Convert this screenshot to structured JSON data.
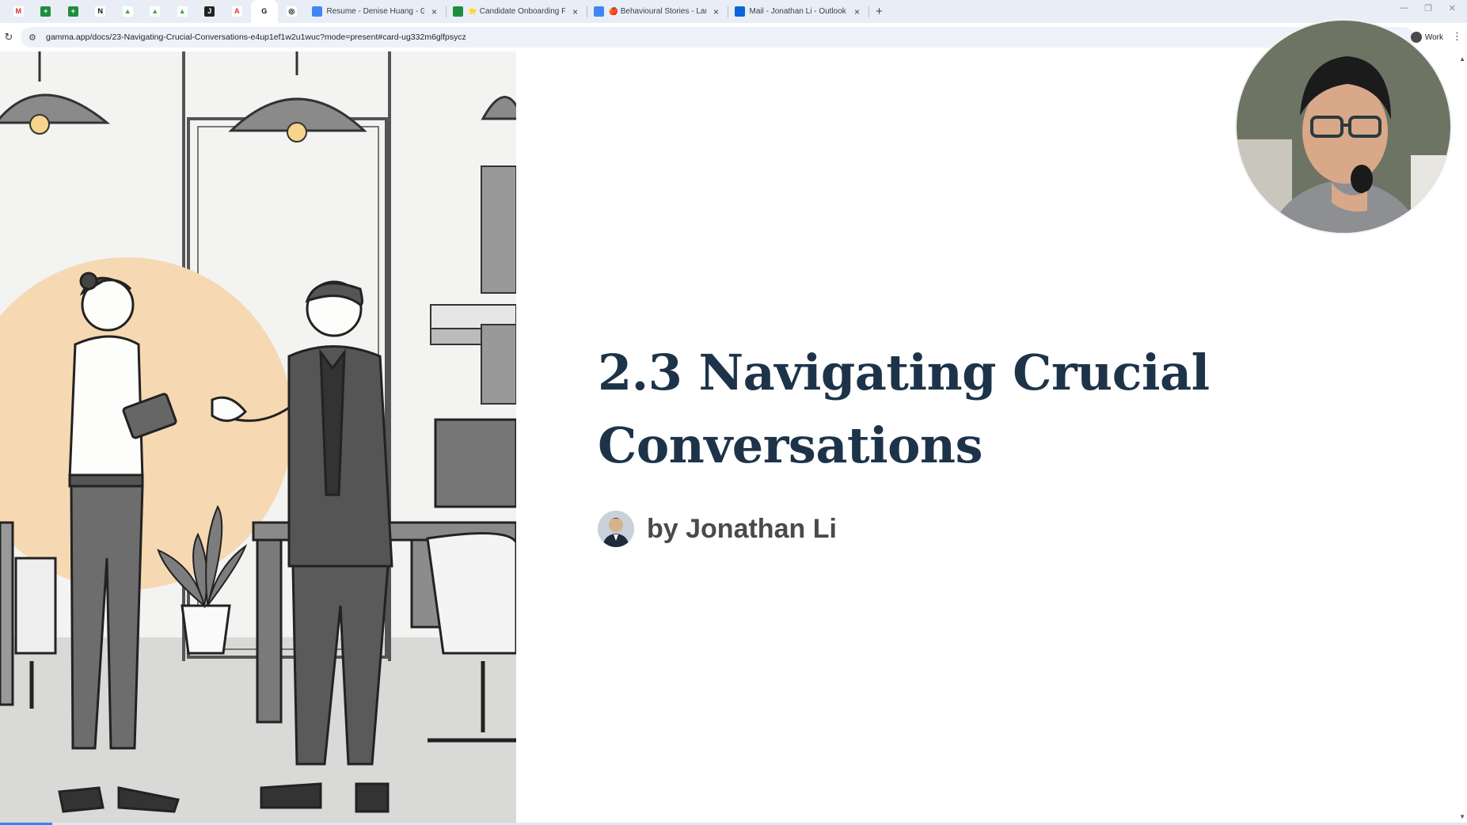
{
  "browser": {
    "pinned_tabs": [
      {
        "icon": "gmail-icon",
        "letter": "M",
        "color": "#ffffff",
        "fg": "#d93025"
      },
      {
        "icon": "sheets-icon",
        "letter": "+",
        "color": "#1e8e3e",
        "fg": "#ffffff"
      },
      {
        "icon": "sheets-icon",
        "letter": "+",
        "color": "#1e8e3e",
        "fg": "#ffffff"
      },
      {
        "icon": "notion-icon",
        "letter": "N",
        "color": "#ffffff",
        "fg": "#111111"
      },
      {
        "icon": "drive-icon",
        "letter": "▲",
        "color": "#ffffff",
        "fg": "#34a853"
      },
      {
        "icon": "drive-icon",
        "letter": "▲",
        "color": "#ffffff",
        "fg": "#34a853"
      },
      {
        "icon": "drive-icon",
        "letter": "▲",
        "color": "#ffffff",
        "fg": "#34a853"
      },
      {
        "icon": "app-icon",
        "letter": "J",
        "color": "#222222",
        "fg": "#ffffff"
      },
      {
        "icon": "acrobat-icon",
        "letter": "A",
        "color": "#ffffff",
        "fg": "#e3322b"
      },
      {
        "icon": "gamma-icon",
        "letter": "G",
        "color": "#ffffff",
        "fg": "#111111"
      },
      {
        "icon": "openai-icon",
        "letter": "◎",
        "color": "#ffffff",
        "fg": "#111111"
      }
    ],
    "tabs": [
      {
        "title": "Resume - Denise Huang - Goo",
        "icon": "docs-icon",
        "color": "#4285f4"
      },
      {
        "title": "⭐ Candidate Onboarding For",
        "icon": "sheets-icon",
        "color": "#1e8e3e"
      },
      {
        "title": "🍎 Behavioural Stories - Laurel",
        "icon": "docs-icon",
        "color": "#4285f4"
      },
      {
        "title": "Mail - Jonathan Li - Outlook",
        "icon": "outlook-icon",
        "color": "#0a64d6"
      }
    ],
    "new_tab": "+",
    "url": "gamma.app/docs/23-Navigating-Crucial-Conversations-e4up1ef1w2u1wuc?mode=present#card-ug332m6glfpsycz",
    "profile_label": "Work"
  },
  "slide": {
    "title_line1": "2.3 Navigating Crucial",
    "title_line2": "Conversations",
    "author": "by Jonathan Li"
  },
  "colors": {
    "title": "#1d3349",
    "author": "#4a4a4a",
    "illustration_accent": "#f6d9b2"
  }
}
